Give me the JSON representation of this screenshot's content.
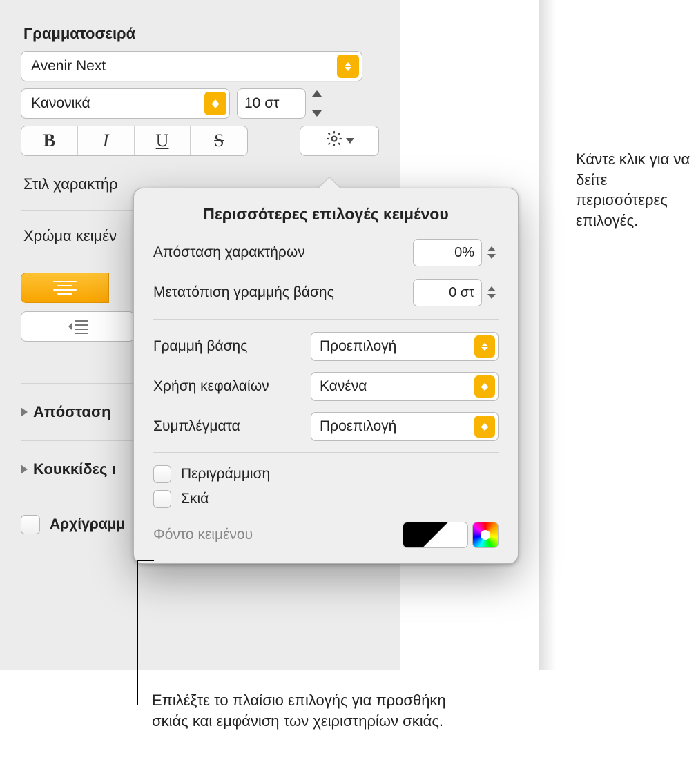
{
  "sidebar": {
    "font_section": "Γραμματοσειρά",
    "font_family": "Avenir Next",
    "font_style": "Κανονικά",
    "font_size": "10 στ",
    "bold": "B",
    "italic": "I",
    "underline": "U",
    "strike": "S",
    "char_styles": "Στιλ χαρακτήρ",
    "text_color": "Χρώμα κειμέν",
    "spacing_header": "Απόσταση",
    "bullets_header": "Κουκκίδες ι",
    "dropcap_label": "Αρχίγραμμ"
  },
  "popover": {
    "title": "Περισσότερες επιλογές κειμένου",
    "char_spacing_label": "Απόσταση χαρακτήρων",
    "char_spacing_value": "0%",
    "baseline_shift_label": "Μετατόπιση γραμμής βάσης",
    "baseline_shift_value": "0 στ",
    "baseline_label": "Γραμμή βάσης",
    "baseline_value": "Προεπιλογή",
    "caps_label": "Χρήση κεφαλαίων",
    "caps_value": "Κανένα",
    "ligatures_label": "Συμπλέγματα",
    "ligatures_value": "Προεπιλογή",
    "outline": "Περιγράμμιση",
    "shadow": "Σκιά",
    "text_bg": "Φόντο κειμένου"
  },
  "callouts": {
    "more_options": "Κάντε κλικ για να δείτε περισσότερες επιλογές.",
    "shadow_note": "Επιλέξτε το πλαίσιο επιλογής για προσθήκη σκιάς και εμφάνιση των χειριστηρίων σκιάς."
  }
}
